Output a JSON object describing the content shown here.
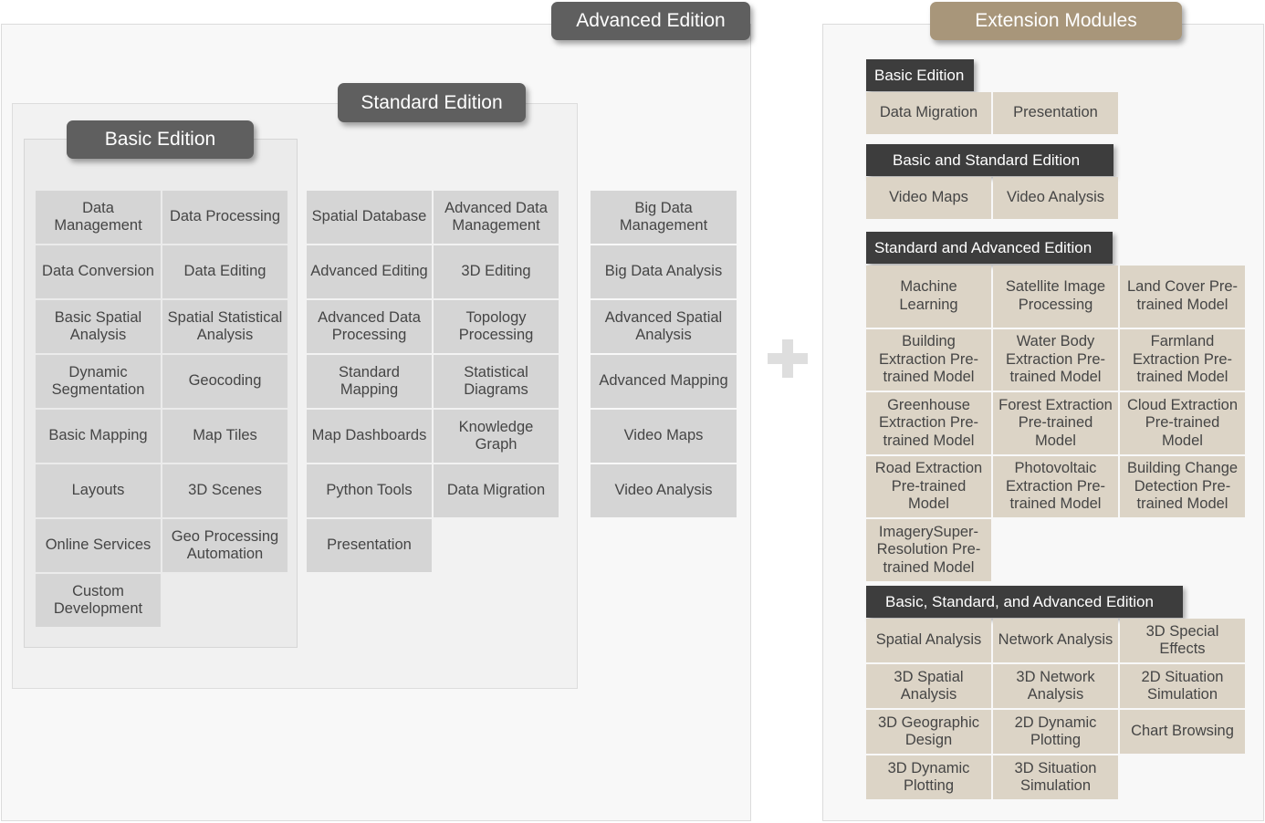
{
  "editions": {
    "advanced_title": "Advanced Edition",
    "standard_title": "Standard Edition",
    "basic_title": "Basic Edition",
    "basic_items": [
      "Data Management",
      "Data Processing",
      "Data Conversion",
      "Data Editing",
      "Basic Spatial Analysis",
      "Spatial Statistical Analysis",
      "Dynamic Segmentation",
      "Geocoding",
      "Basic Mapping",
      "Map Tiles",
      "Layouts",
      "3D Scenes",
      "Online Services",
      "Geo Processing Automation",
      "Custom Development"
    ],
    "standard_items": [
      "Spatial Database",
      "Advanced Data Management",
      "Advanced Editing",
      "3D Editing",
      "Advanced Data Processing",
      "Topology Processing",
      "Standard Mapping",
      "Statistical Diagrams",
      "Map Dashboards",
      "Knowledge Graph",
      "Python Tools",
      "Data Migration",
      "Presentation"
    ],
    "advanced_items": [
      "Big Data Management",
      "Big Data Analysis",
      "Advanced Spatial Analysis",
      "Advanced Mapping",
      "Video Maps",
      "Video Analysis"
    ]
  },
  "extension": {
    "title": "Extension Modules",
    "groups": [
      {
        "header": "Basic Edition",
        "items": [
          "Data Migration",
          "Presentation"
        ]
      },
      {
        "header": "Basic and Standard Edition",
        "items": [
          "Video Maps",
          "Video Analysis"
        ]
      },
      {
        "header": "Standard and Advanced Edition",
        "items": [
          "Machine Learning",
          "Satellite Image Processing",
          "Land Cover Pre-trained Model",
          "Building Extraction Pre-trained Model",
          "Water Body Extraction Pre-trained Model",
          "Farmland Extraction Pre-trained Model",
          "Greenhouse Extraction Pre-trained Model",
          "Forest Extraction Pre-trained Model",
          "Cloud Extraction Pre-trained Model",
          "Road Extraction Pre-trained Model",
          "Photovoltaic Extraction Pre-trained Model",
          "Building Change Detection Pre-trained Model",
          "ImagerySuper-Resolution Pre-trained Model"
        ]
      },
      {
        "header": "Basic, Standard, and Advanced Edition",
        "items": [
          "Spatial Analysis",
          "Network Analysis",
          "3D Special Effects",
          "3D Spatial Analysis",
          "3D Network Analysis",
          "2D Situation Simulation",
          "3D Geographic Design",
          "2D Dynamic Plotting",
          "Chart Browsing",
          "3D Dynamic Plotting",
          "3D Situation Simulation"
        ]
      }
    ]
  },
  "colors": {
    "edition_pill": "#5f5f5f",
    "extension_pill": "#a8967a",
    "edition_cell": "#d5d5d5",
    "extension_cell": "#dcd4c6",
    "group_header": "#3d3d3d"
  },
  "icons": {
    "combine": "plus-icon"
  }
}
